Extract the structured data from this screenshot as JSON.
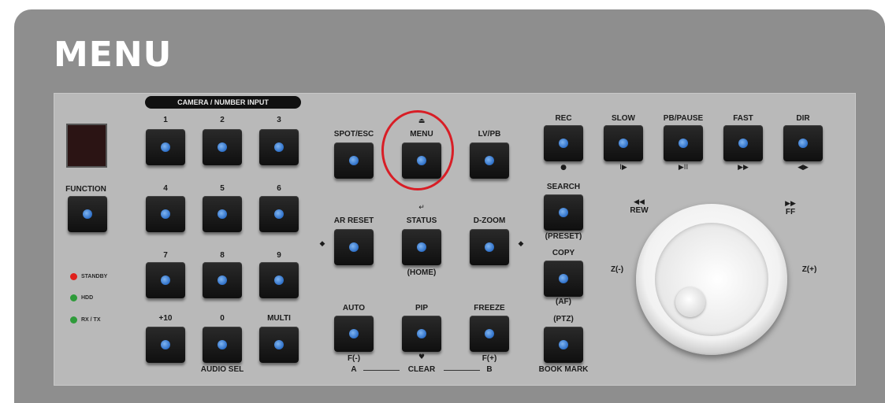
{
  "page": {
    "title": "MENU"
  },
  "panel": {
    "camera_header": "CAMERA / NUMBER INPUT",
    "function_label": "FUNCTION",
    "leds": [
      {
        "label": "STANDBY",
        "color": "#e0201c"
      },
      {
        "label": "HDD",
        "color": "#2e9b3a"
      },
      {
        "label": "RX / TX",
        "color": "#2e9b3a"
      }
    ],
    "number_keys": [
      "1",
      "2",
      "3",
      "4",
      "5",
      "6",
      "7",
      "8",
      "9",
      "+10",
      "0",
      "MULTI"
    ],
    "audio_sel": "AUDIO SEL",
    "center_keys": {
      "spot_esc": "SPOT/ESC",
      "menu": "MENU",
      "menu_symbol": "⏏",
      "lv_pb": "LV/PB",
      "ar_reset": "AR RESET",
      "status": "STATUS",
      "status_symbol": "↵",
      "home": "(HOME)",
      "d_zoom": "D-ZOOM",
      "left_arrow": "◆",
      "right_arrow": "◆",
      "auto": "AUTO",
      "f_minus": "F(-)",
      "pip": "PIP",
      "clear_symbol": "♥",
      "freeze": "FREEZE",
      "f_plus": "F(+)",
      "a": "A",
      "clear": "CLEAR",
      "b": "B"
    },
    "right_keys": {
      "rec": "REC",
      "rec_sym": "●",
      "slow": "SLOW",
      "slow_sym": "I▶",
      "pb_pause": "PB/PAUSE",
      "pb_pause_sym": "▶II",
      "fast": "FAST",
      "fast_sym": "▶▶",
      "dir": "DIR",
      "dir_sym": "◀▶",
      "search": "SEARCH",
      "preset": "(PRESET)",
      "copy": "COPY",
      "af": "(AF)",
      "ptz": "(PTZ)",
      "bookmark": "BOOK MARK"
    },
    "jog": {
      "rew_sym": "◀◀",
      "rew": "REW",
      "ff_sym": "▶▶",
      "ff": "FF",
      "z_minus": "Z(-)",
      "z_plus": "Z(+)"
    }
  }
}
